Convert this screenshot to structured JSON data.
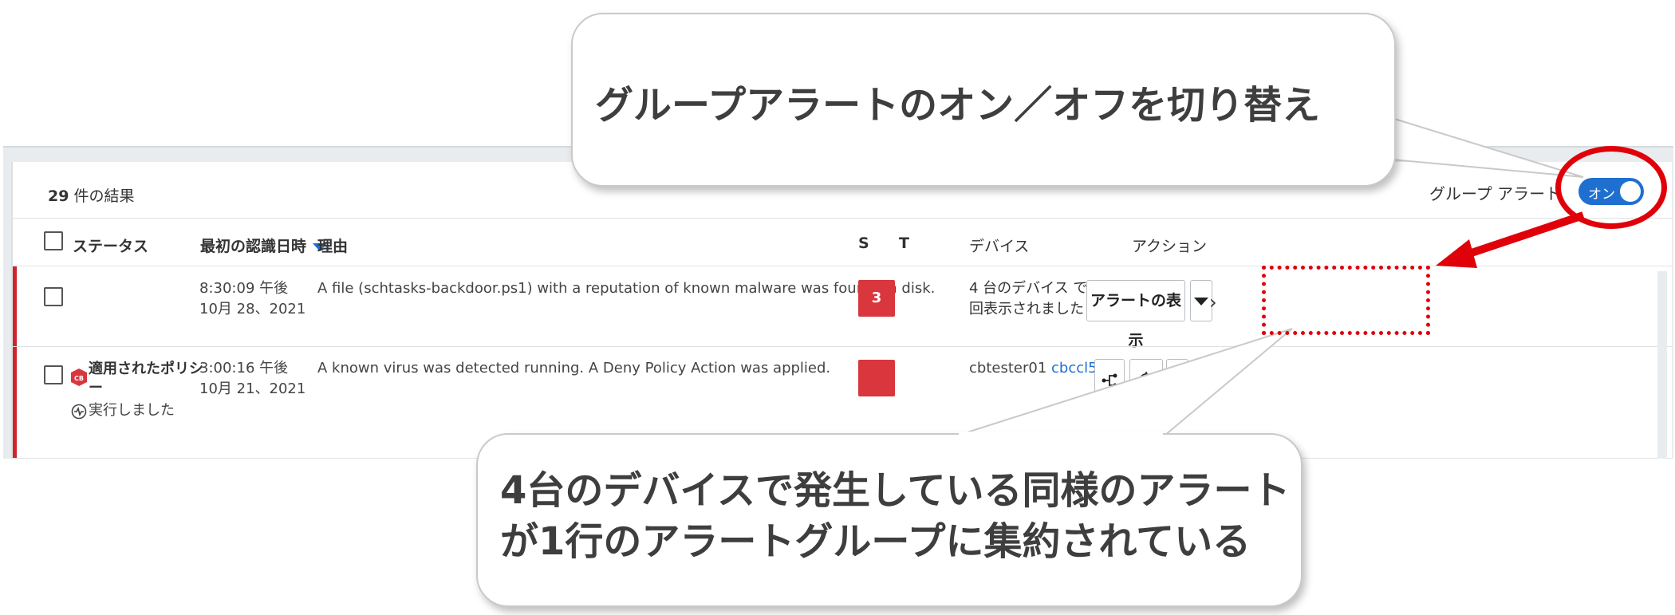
{
  "results": {
    "count": "29",
    "suffix": " 件の結果"
  },
  "group_alert": {
    "label": "グループ アラート",
    "toggle_state": "オン",
    "enabled": true
  },
  "columns": {
    "status": "ステータス",
    "first_seen": "最初の認識日時",
    "reason": "理由",
    "s": "S",
    "t": "T",
    "device": "デバイス",
    "action": "アクション"
  },
  "rows": [
    {
      "time": "8:30:09 午後",
      "date": "10月 28、2021",
      "reason": "A file (schtasks-backdoor.ps1) with a reputation of known malware was found on disk.",
      "severity": "3",
      "device_line1": "4 台のデバイス で 5",
      "device_line2": "回表示されました",
      "action_button": "アラートの表示"
    },
    {
      "status_policy": "適用されたポリシ",
      "status_policy_cont": "ー",
      "status_run": "実行しました",
      "badge": "CB",
      "time": "3:00:16 午後",
      "date": "10月 21、2021",
      "reason": "A known virus was detected running. A Deny Policy Action was applied.",
      "device_name": "cbtester01",
      "device_user": "cbccl501"
    }
  ],
  "callouts": {
    "top": "グループアラートのオン／オフを切り替え",
    "bottom_line1": "4台のデバイスで発生している同様のアラート",
    "bottom_line2": "が1行のアラートグループに集約されている"
  },
  "colors": {
    "accent_blue": "#1f6fd1",
    "severity_red": "#d9363e",
    "highlight_red": "#e0000a"
  }
}
